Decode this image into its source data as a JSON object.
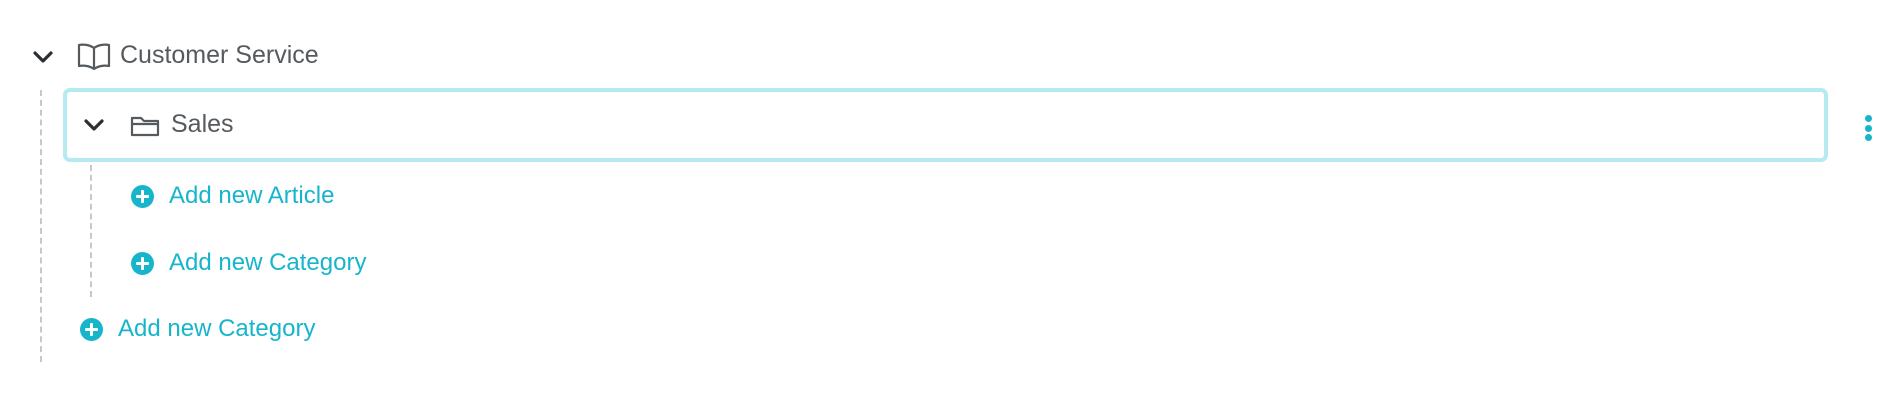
{
  "tree": {
    "root": {
      "label": "Customer Service",
      "expand_icon": "chevron-down-icon",
      "type_icon": "book-open-icon"
    },
    "category": {
      "label": "Sales",
      "expand_icon": "chevron-down-icon",
      "type_icon": "folder-icon",
      "menu_icon": "more-vertical-icon"
    },
    "category_actions": {
      "add_article": "Add new Article",
      "add_category": "Add new Category"
    },
    "root_actions": {
      "add_category": "Add new Category"
    }
  },
  "colors": {
    "accent": "#17b5cc",
    "selected_border": "#b4eaf0",
    "text": "#555a5e",
    "guide_line": "#c8c8c8"
  }
}
